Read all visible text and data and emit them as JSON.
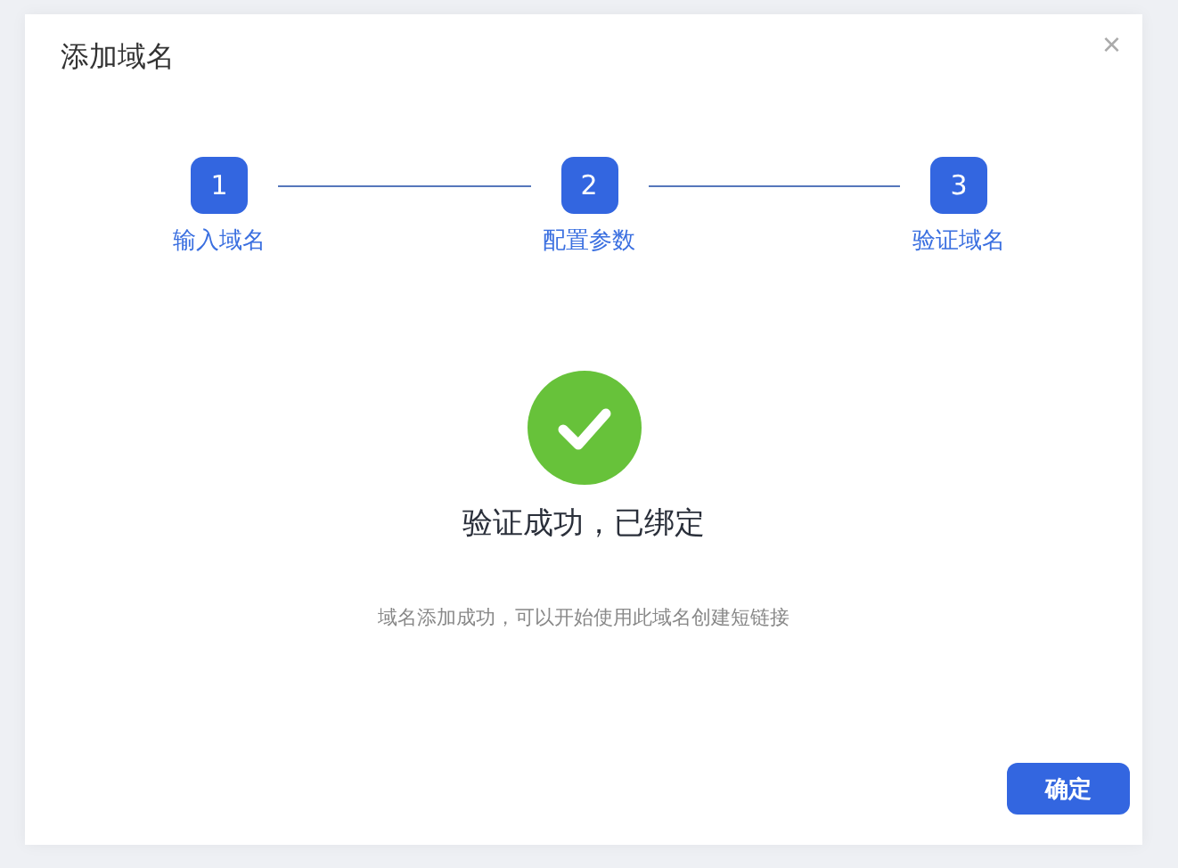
{
  "dialog": {
    "title": "添加域名",
    "close": "×"
  },
  "steps": [
    {
      "number": "1",
      "label": "输入域名",
      "done": true
    },
    {
      "number": "2",
      "label": "配置参数",
      "done": true
    },
    {
      "number": "3",
      "label": "验证域名",
      "done": true
    }
  ],
  "result": {
    "title": "验证成功，已绑定",
    "message": "域名添加成功，可以开始使用此域名创建短链接"
  },
  "buttons": [
    "确定"
  ]
}
